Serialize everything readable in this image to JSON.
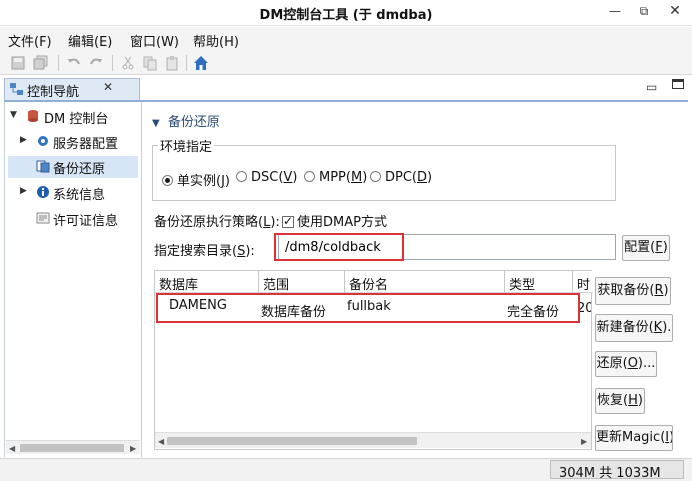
{
  "window": {
    "title": "DM控制台工具 (于 dmdba)",
    "controls": [
      "minimize",
      "maximize",
      "close"
    ]
  },
  "menu": [
    "文件(F)",
    "编辑(E)",
    "窗口(W)",
    "帮助(H)"
  ],
  "toolbar": [
    "save-icon",
    "save-all-icon",
    "undo-icon",
    "redo-icon",
    "cut-icon",
    "copy-icon",
    "paste-icon",
    "home-icon"
  ],
  "nav": {
    "tab_label": "控制导航",
    "close_glyph": "✕",
    "items": [
      {
        "label": "DM 控制台",
        "icon": "database-icon",
        "expanded": true
      },
      {
        "label": "服务器配置",
        "icon": "gear-icon"
      },
      {
        "label": "备份还原",
        "icon": "backup-icon",
        "selected": true
      },
      {
        "label": "系统信息",
        "icon": "info-icon"
      },
      {
        "label": "许可证信息",
        "icon": "license-icon"
      }
    ]
  },
  "main": {
    "section_title": "备份还原",
    "env_group_label": "环境指定",
    "env_options": [
      {
        "label": "单实例(",
        "key": "J",
        "tail": ")",
        "selected": true
      },
      {
        "label": "DSC(",
        "key": "V",
        "tail": ")",
        "selected": false
      },
      {
        "label": "MPP(",
        "key": "M",
        "tail": ")",
        "selected": false
      },
      {
        "label": "DPC(",
        "key": "D",
        "tail": ")",
        "selected": false
      }
    ],
    "strategy_label_pre": "备份还原执行策略(",
    "strategy_key": "L",
    "strategy_label_post": "):",
    "dmap_label": "使用DMAP方式",
    "dmap_checked": true,
    "dir_label_pre": "指定搜索目录(",
    "dir_key": "S",
    "dir_label_post": "):",
    "dir_value": "/dm8/coldback",
    "config_button": {
      "label": "配置(",
      "key": "F",
      "tail": ")"
    },
    "table": {
      "columns": [
        "数据库",
        "范围",
        "备份名",
        "类型",
        "时"
      ],
      "rows": [
        {
          "db": "DAMENG",
          "scope": "数据库备份",
          "name": "fullbak",
          "type": "完全备份",
          "time": "20"
        }
      ]
    },
    "actions": [
      {
        "label": "获取备份(",
        "key": "R",
        "tail": ")"
      },
      {
        "label": "新建备份(",
        "key": "K",
        "tail": ")."
      },
      {
        "label": "还原(",
        "key": "O",
        "tail": ")..."
      },
      {
        "label": "恢复(",
        "key": "H",
        "tail": ")"
      },
      {
        "label": "更新Magic(",
        "key": "I",
        "tail": ")"
      }
    ]
  },
  "status": {
    "memory": "304M 共 1033M"
  },
  "colors": {
    "accent_blue": "#2a4d78",
    "highlight_red": "#d9333a",
    "selection": "#d7e6f6"
  }
}
